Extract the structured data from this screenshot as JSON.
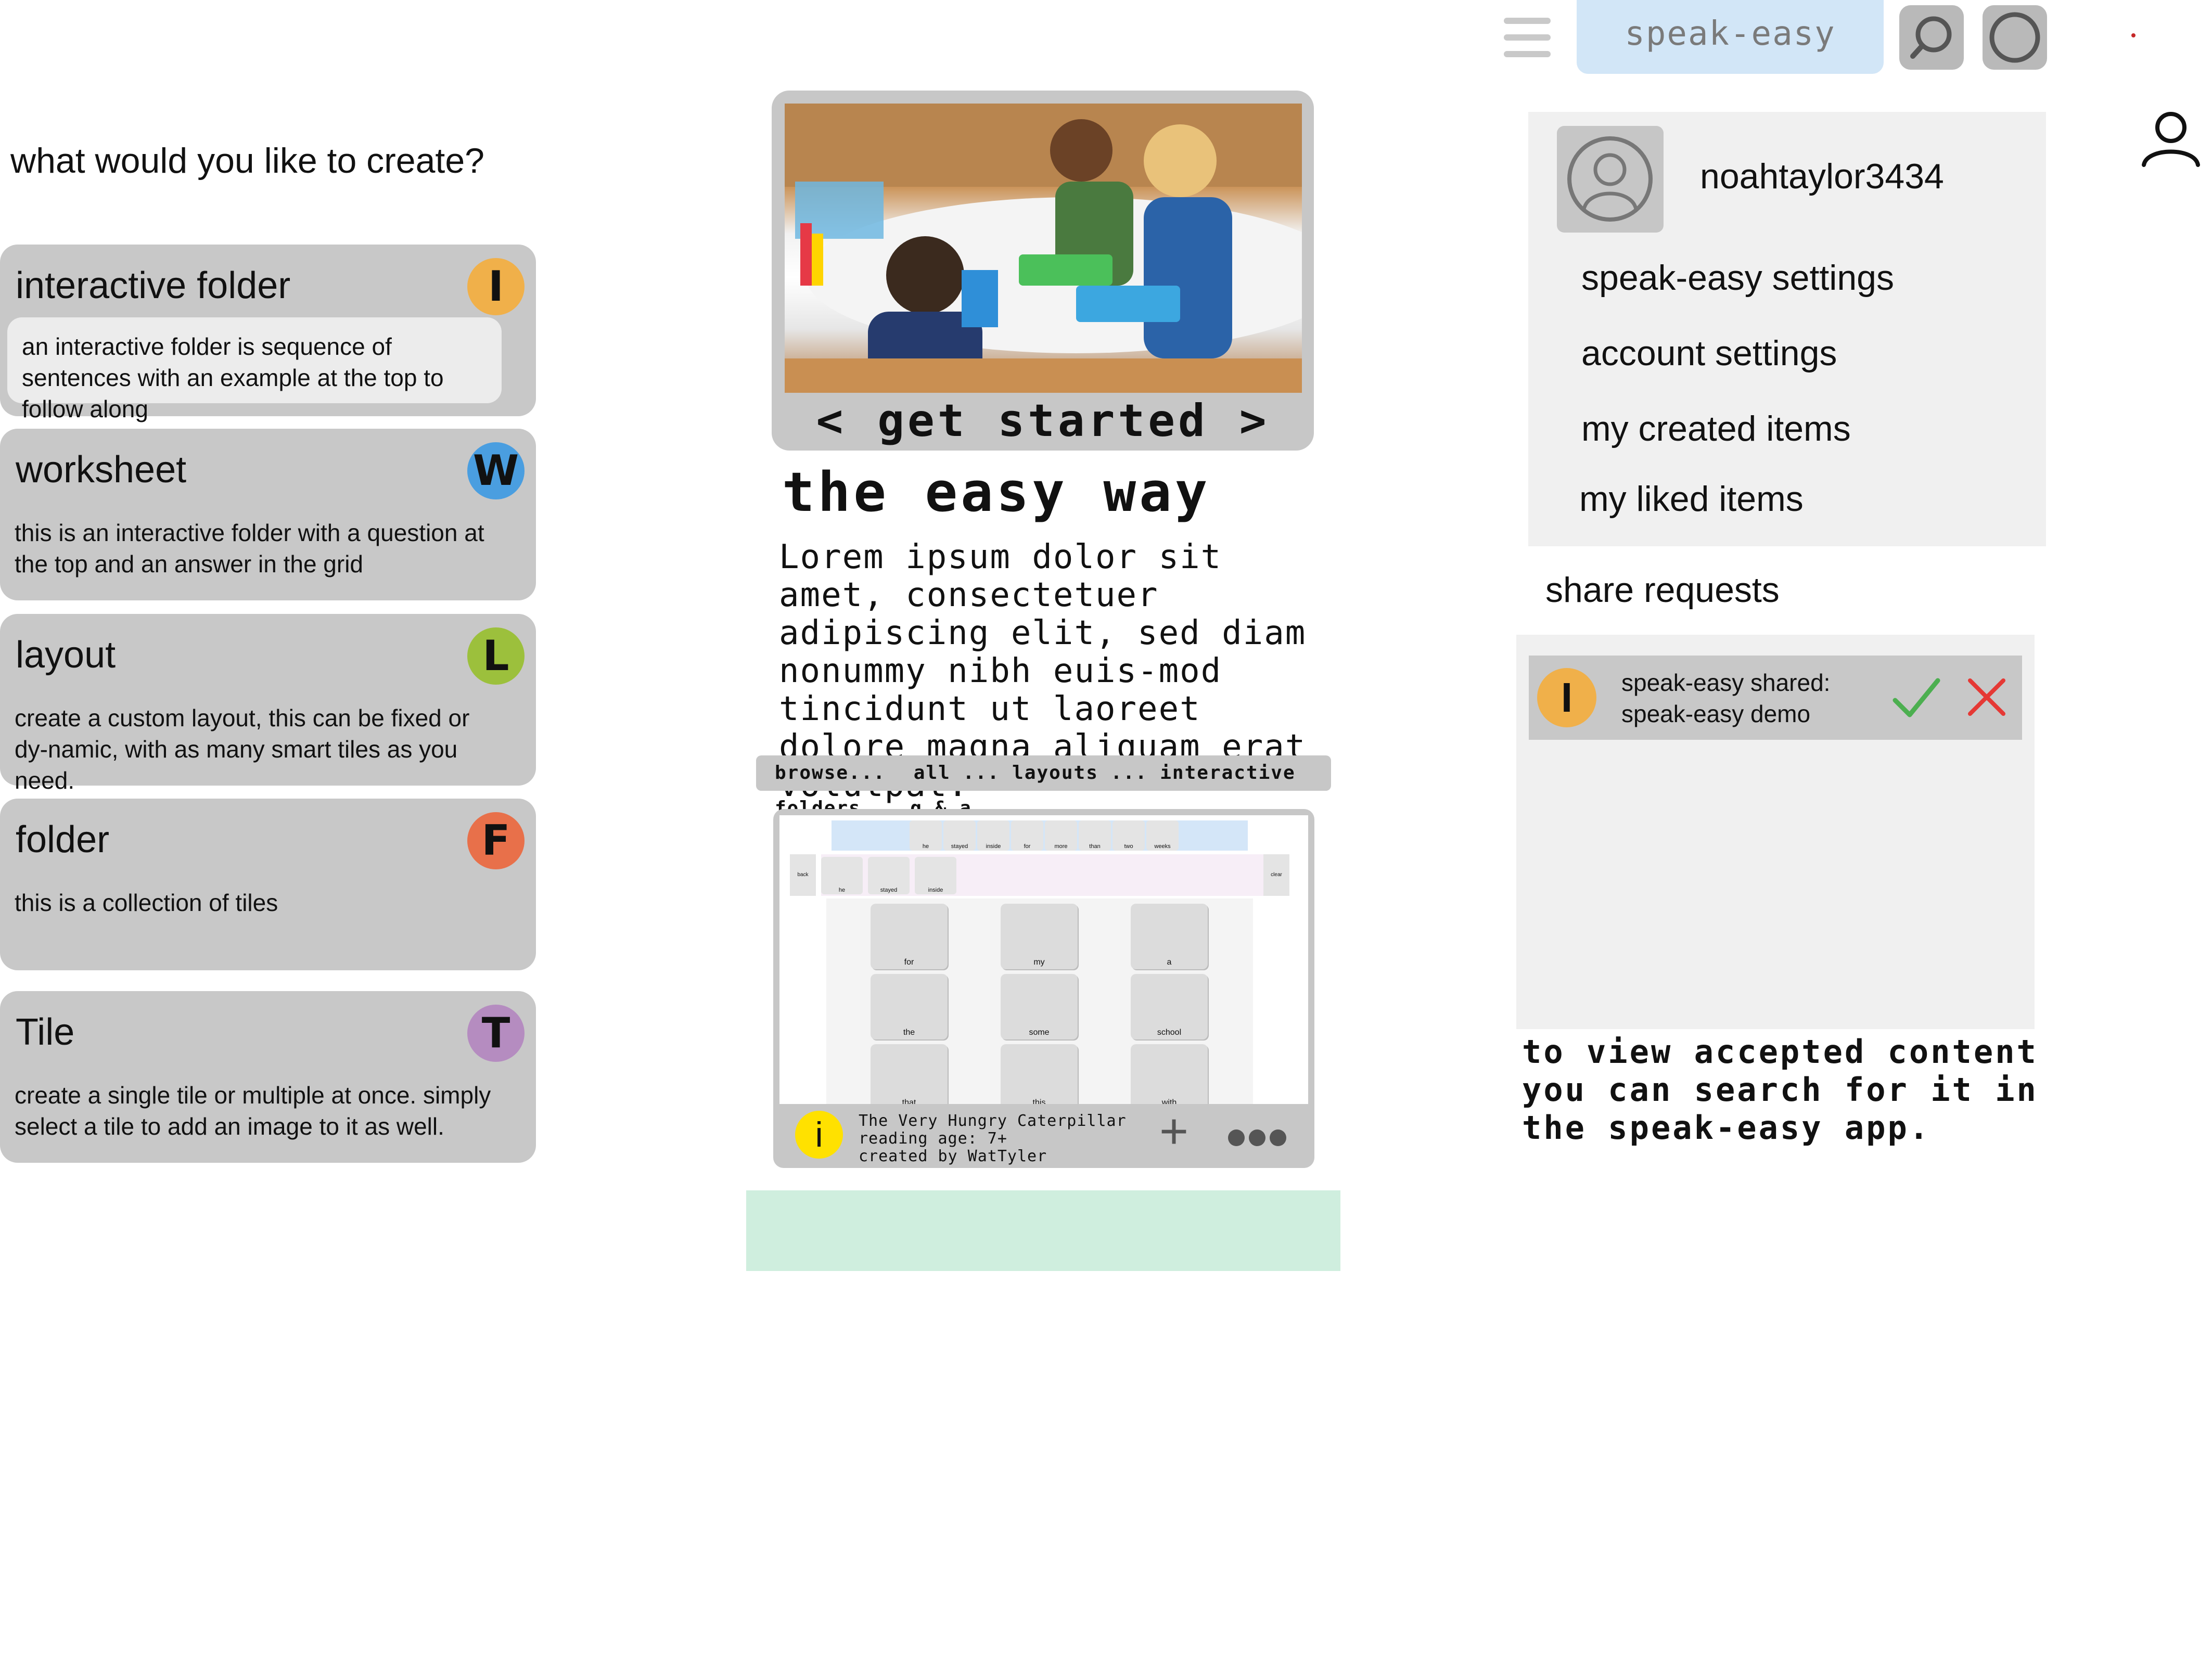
{
  "colors": {
    "card_bg": "#c8c8c8",
    "badge_interactive_folder": "#f0b04a",
    "badge_worksheet": "#4a9ee0",
    "badge_layout": "#9cc03c",
    "badge_folder": "#e8704a",
    "badge_tile": "#b58cc0",
    "app_name_bg": "#d2e6f7",
    "accept": "#4caf50",
    "reject": "#e53935"
  },
  "create": {
    "prompt": "what would you like to create?",
    "cards": [
      {
        "title": "interactive folder",
        "badge": "I",
        "description": "an interactive folder is sequence of sentences with an example at the top to follow along"
      },
      {
        "title": "worksheet",
        "badge": "W",
        "description": "this is an interactive folder with a question at the top and an answer in the grid"
      },
      {
        "title": "layout",
        "badge": "L",
        "description": "create a custom layout, this can be fixed or dy-namic, with as many smart tiles as you need."
      },
      {
        "title": "folder",
        "badge": "F",
        "description": "this is a collection of tiles"
      },
      {
        "title": "Tile",
        "badge": "T",
        "description": "create a single tile or multiple at once. simply select a tile to add an image to it as well."
      }
    ]
  },
  "topbar": {
    "menu_icon": "hamburger-icon",
    "app_name": "speak-easy",
    "search_icon": "search-icon",
    "circle_icon": "circle-icon",
    "user_icon": "user-icon"
  },
  "hero": {
    "prev": "<",
    "caption": "get started",
    "next": ">",
    "tagline": "the easy way",
    "body": "Lorem ipsum dolor sit amet, consectetuer adipiscing elit, sed diam nonummy nibh euis-mod tincidunt ut laoreet dolore magna aliquam erat volutpat."
  },
  "browse": {
    "label": "browse...",
    "filters": "all ... layouts ... interactive folders .. q & a"
  },
  "preview": {
    "sentence_words": [
      "he",
      "stayed",
      "inside",
      "for",
      "more",
      "than",
      "two",
      "weeks"
    ],
    "sentence_bar_words": [
      "he",
      "stayed",
      "inside"
    ],
    "back_label": "back",
    "clear_label": "clear",
    "grid": [
      [
        "for",
        "my",
        "a"
      ],
      [
        "the",
        "some",
        "school"
      ],
      [
        "that",
        "this",
        "with"
      ]
    ],
    "info_badge": "i",
    "title": "The Very Hungry Caterpillar",
    "reading_age": "reading age: 7+",
    "creator": "created  by WatTyler",
    "add_label": "+",
    "more_icon": "more-dots-icon"
  },
  "profile": {
    "username": "noahtaylor3434",
    "menu": [
      "speak-easy settings",
      "account settings",
      "my created items",
      "my liked items"
    ]
  },
  "share": {
    "title": "share requests",
    "requests": [
      {
        "badge": "I",
        "line1": "speak-easy shared:",
        "line2": "speak-easy demo"
      }
    ],
    "note": "to view accepted content you can search for it in the speak-easy app."
  }
}
